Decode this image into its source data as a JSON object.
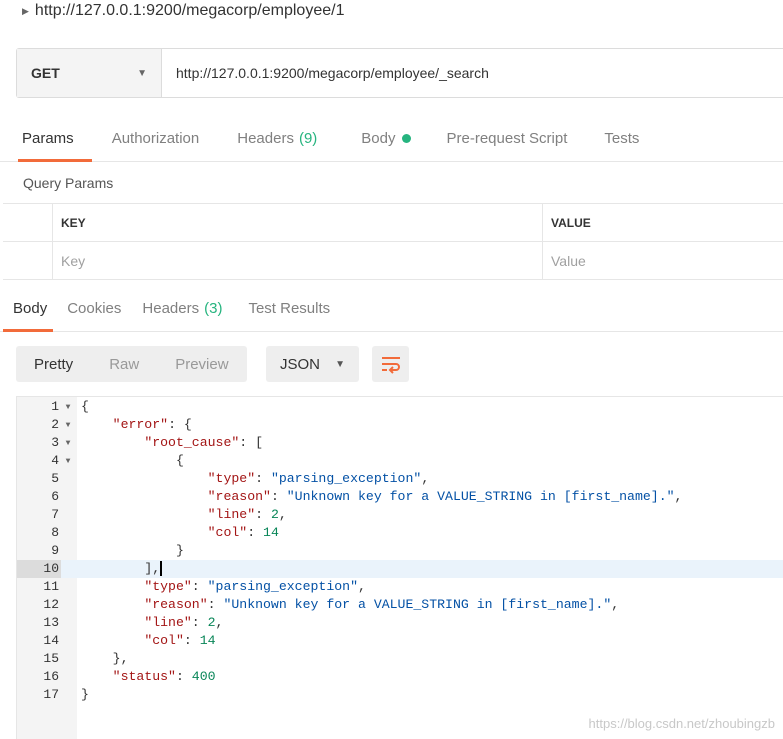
{
  "request": {
    "name": "http://127.0.0.1:9200/megacorp/employee/1",
    "method": "GET",
    "url": "http://127.0.0.1:9200/megacorp/employee/_search"
  },
  "request_tabs": [
    {
      "label": "Params",
      "count": ""
    },
    {
      "label": "Authorization",
      "count": ""
    },
    {
      "label": "Headers",
      "count": "(9)"
    },
    {
      "label": "Body",
      "count": ""
    },
    {
      "label": "Pre-request Script",
      "count": ""
    },
    {
      "label": "Tests",
      "count": ""
    }
  ],
  "query_params": {
    "title": "Query Params",
    "key_header": "KEY",
    "value_header": "VALUE",
    "key_placeholder": "Key",
    "value_placeholder": "Value"
  },
  "response_tabs": [
    {
      "label": "Body",
      "count": ""
    },
    {
      "label": "Cookies",
      "count": ""
    },
    {
      "label": "Headers",
      "count": "(3)"
    },
    {
      "label": "Test Results",
      "count": ""
    }
  ],
  "view_modes": [
    "Pretty",
    "Raw",
    "Preview"
  ],
  "format": "JSON",
  "icons": {
    "wrap": "wrap-lines-icon",
    "caret": "caret-right-icon",
    "dropdown": "chevron-down-icon"
  },
  "colors": {
    "accent": "#f26b3a",
    "count": "#26b47f"
  },
  "watermark": "https://blog.csdn.net/zhoubingzb"
}
